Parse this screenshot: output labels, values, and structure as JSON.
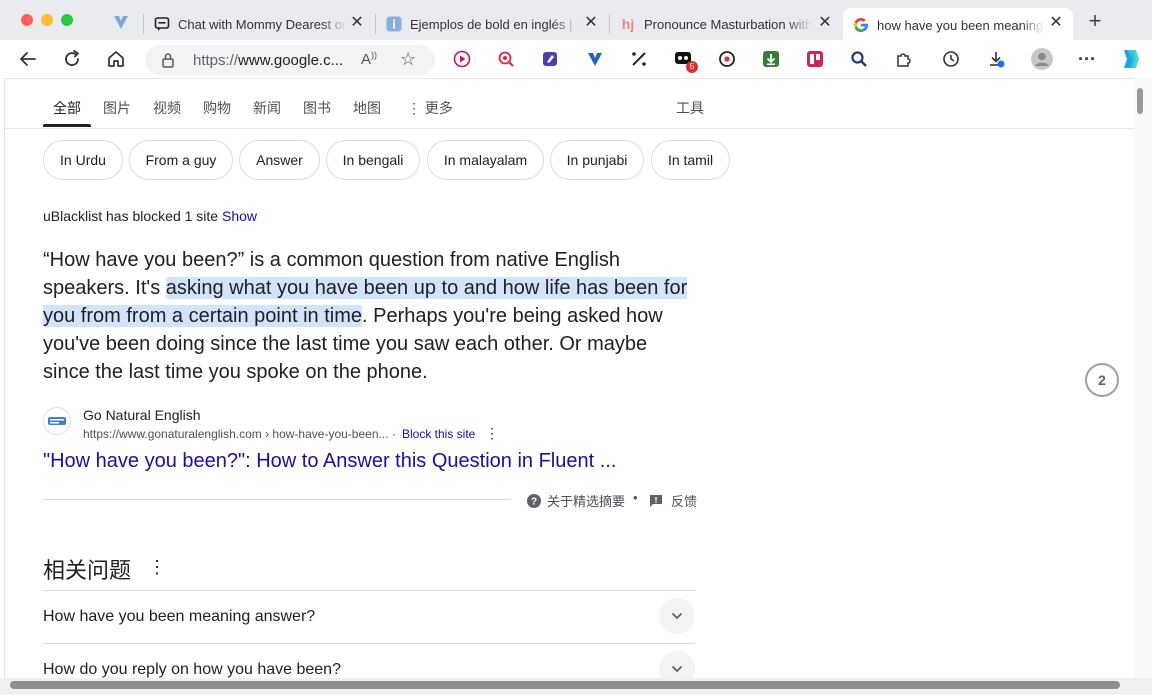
{
  "browser": {
    "tabs": [
      {
        "title": "Chat with Mommy Dearest on",
        "icon": "chat-icon"
      },
      {
        "title": "Ejemplos de bold en inglés | in",
        "icon": "info-icon"
      },
      {
        "title": "Pronounce Masturbation with",
        "icon": "hj-icon"
      },
      {
        "title": "how have you been meaning",
        "icon": "google-icon",
        "active": true
      }
    ],
    "address": {
      "prefix": "https://",
      "host": "www.google.c..."
    },
    "extension_badge": "5"
  },
  "google": {
    "nav": {
      "all": "全部",
      "images": "图片",
      "videos": "视频",
      "shopping": "购物",
      "news": "新闻",
      "books": "图书",
      "maps": "地图",
      "more": "更多",
      "tools": "工具"
    },
    "chips": [
      "In Urdu",
      "From a guy",
      "Answer",
      "In bengali",
      "In malayalam",
      "In punjabi",
      "In tamil"
    ],
    "blocked": {
      "text": "uBlacklist has blocked 1 site",
      "show": "Show"
    },
    "snippet": {
      "before": "“How have you been?” is a common question from native English speakers. It's ",
      "highlight": "asking what you have been up to and how life has been for you from from a certain point in time",
      "after": ". Perhaps you're being asked how you've been doing since the last time you saw each other. Or maybe since the last time you spoke on the phone."
    },
    "source": {
      "name": "Go Natural English",
      "url": "https://www.gonaturalenglish.com › how-have-you-been...",
      "separator": "·",
      "block": "Block this site",
      "link": "\"How have you been?\": How to Answer this Question in Fluent ..."
    },
    "feedback": {
      "about": "关于精选摘要",
      "dot": "•",
      "feedback": "反馈"
    },
    "related": {
      "title": "相关问题",
      "questions": [
        "How have you been meaning answer?",
        "How do you reply on how you have been?"
      ]
    },
    "page_indicator": "2"
  }
}
